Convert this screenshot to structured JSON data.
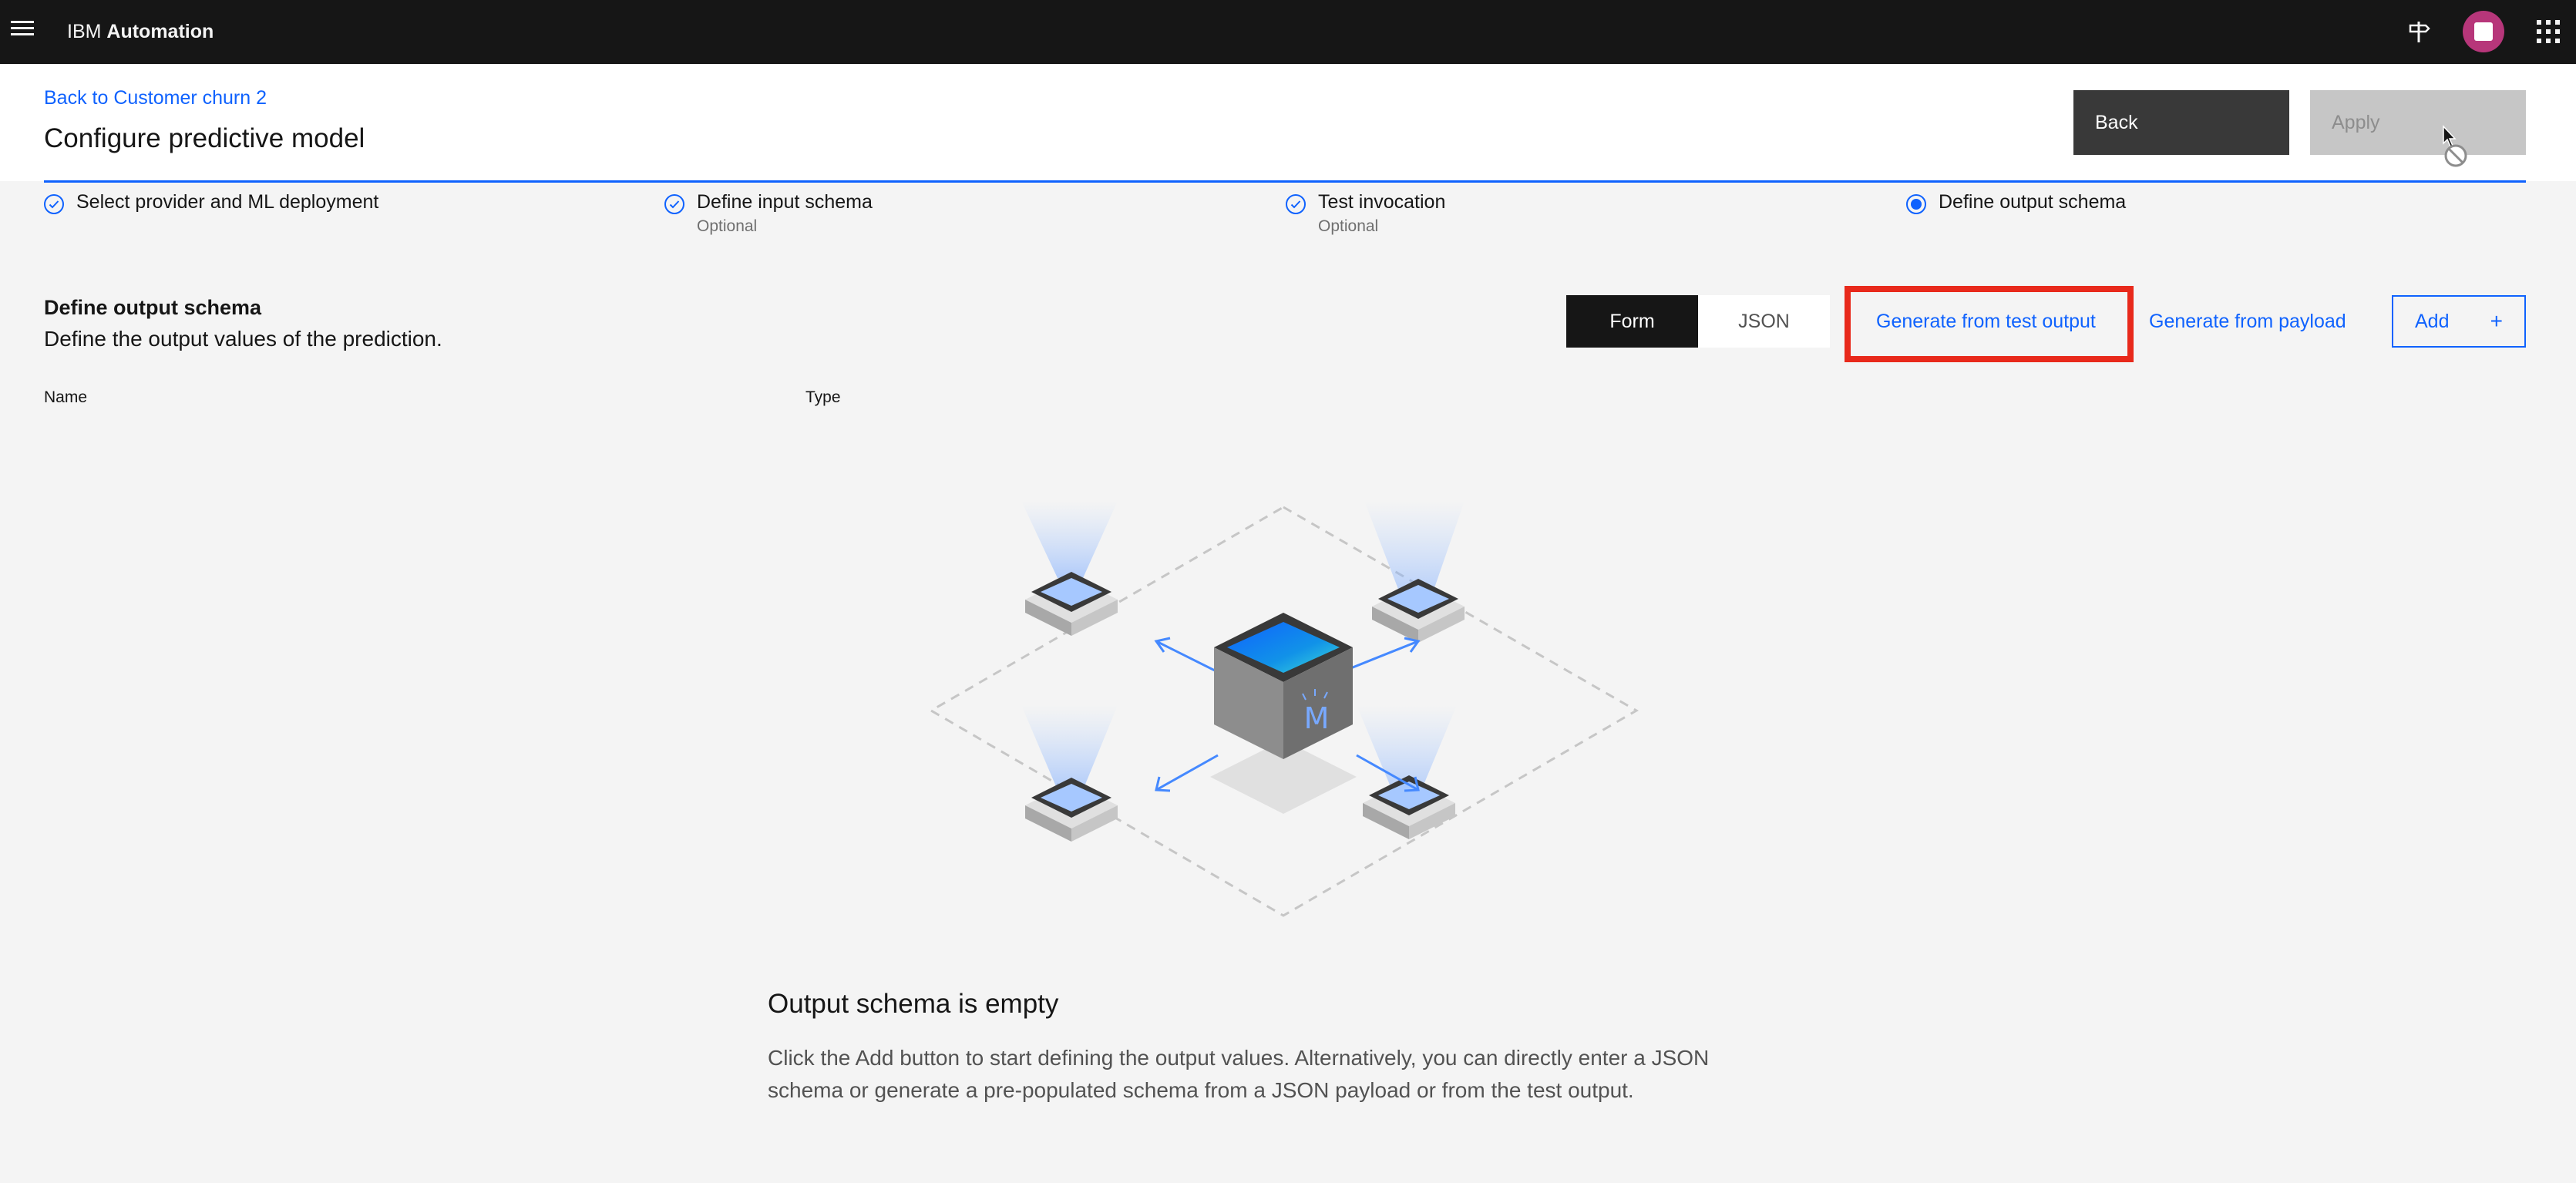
{
  "topbar": {
    "brand_prefix": "IBM",
    "brand_name": "Automation",
    "icons": [
      "menu-icon",
      "help-signpost-icon",
      "avatar",
      "app-switcher-icon"
    ],
    "colors": {
      "bar": "#161616",
      "avatar": "#b7367a"
    }
  },
  "header": {
    "back_link": "Back to Customer churn 2",
    "title": "Configure predictive model",
    "back_button": "Back",
    "apply_button": "Apply"
  },
  "steps": [
    {
      "label": "Select provider and ML deployment",
      "sub": "",
      "state": "complete"
    },
    {
      "label": "Define input schema",
      "sub": "Optional",
      "state": "complete"
    },
    {
      "label": "Test invocation",
      "sub": "Optional",
      "state": "complete"
    },
    {
      "label": "Define output schema",
      "sub": "",
      "state": "current"
    }
  ],
  "section": {
    "title": "Define output schema",
    "description": "Define the output values of the prediction.",
    "toggle": {
      "form": "Form",
      "json": "JSON",
      "selected": "Form"
    },
    "generate_test": "Generate from test output",
    "generate_payload": "Generate from payload",
    "add": "Add",
    "add_icon": "+",
    "columns": {
      "name": "Name",
      "type": "Type"
    }
  },
  "empty_state": {
    "title": "Output schema is empty",
    "description": "Click the Add button to start defining the output values. Alternatively, you can directly enter a JSON schema or generate a pre-populated schema from a JSON payload or from the test output.",
    "illustration": "model-distribution-illustration",
    "cube_glyph": "M"
  },
  "colors": {
    "accent": "#0f62fe",
    "highlight": "#e8291b",
    "background": "#f4f4f4"
  }
}
